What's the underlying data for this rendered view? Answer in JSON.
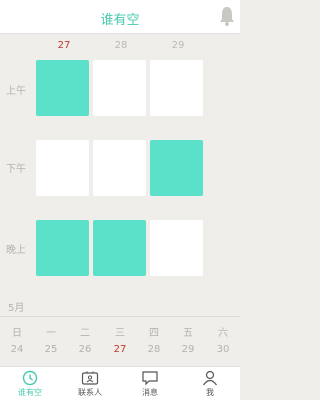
{
  "app": {
    "title": "谁有空"
  },
  "schedule": {
    "dates": [
      {
        "label": "27",
        "today": true
      },
      {
        "label": "28",
        "today": false
      },
      {
        "label": "29",
        "today": false
      }
    ],
    "periods": [
      {
        "label": "上午",
        "slots": [
          true,
          false,
          false
        ]
      },
      {
        "label": "下午",
        "slots": [
          false,
          false,
          true
        ]
      },
      {
        "label": "晚上",
        "slots": [
          true,
          true,
          false
        ]
      }
    ]
  },
  "calendar": {
    "month": "5月",
    "weekdays": [
      "日",
      "一",
      "二",
      "三",
      "四",
      "五",
      "六"
    ],
    "dates": [
      "24",
      "25",
      "26",
      "27",
      "28",
      "29",
      "30"
    ],
    "today_index": 3
  },
  "tabbar": {
    "items": [
      {
        "label": "谁有空",
        "icon": "clock-icon",
        "active": true
      },
      {
        "label": "联系人",
        "icon": "contact-card-icon",
        "active": false
      },
      {
        "label": "消息",
        "icon": "chat-bubble-icon",
        "active": false
      },
      {
        "label": "我",
        "icon": "user-icon",
        "active": false
      }
    ]
  },
  "colors": {
    "accent": "#47c9ad",
    "busy": "#5be0c9",
    "today": "#c0392b"
  }
}
